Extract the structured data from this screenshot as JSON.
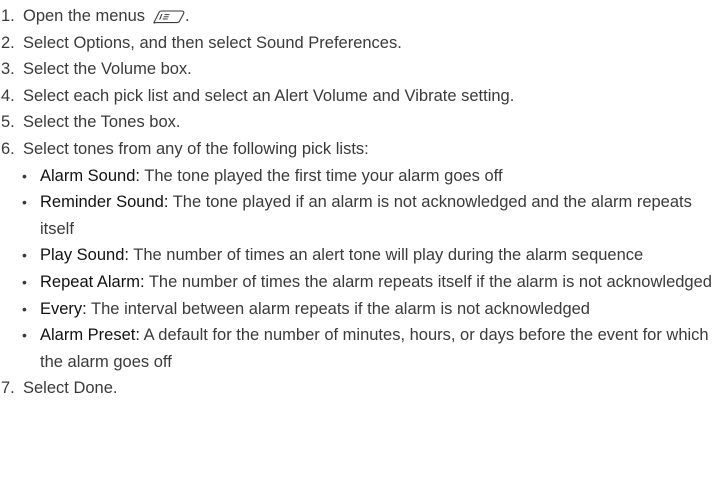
{
  "steps": [
    {
      "num": "1.",
      "text": "Open the menus",
      "suffix": ".",
      "icon": "menu-key-icon"
    },
    {
      "num": "2.",
      "text": "Select Options, and then select Sound Preferences."
    },
    {
      "num": "3.",
      "text": "Select the Volume box."
    },
    {
      "num": "4.",
      "text": "Select each pick list and select an Alert Volume and Vibrate setting."
    },
    {
      "num": "5.",
      "text": "Select the Tones box."
    },
    {
      "num": "6.",
      "text": "Select tones from any of the following pick lists:"
    },
    {
      "num": "7.",
      "text": "Select Done."
    }
  ],
  "bullets": [
    {
      "dot": "•",
      "term": "Alarm Sound:",
      "desc": " The tone played the first time your alarm goes off"
    },
    {
      "dot": "•",
      "term": "Reminder Sound:",
      "desc": " The tone played if an alarm is not acknowledged and the alarm repeats itself"
    },
    {
      "dot": "•",
      "term": "Play Sound:",
      "desc": " The number of times an alert tone will play during the alarm sequence"
    },
    {
      "dot": "•",
      "term": "Repeat Alarm:",
      "desc": " The number of times the alarm repeats itself if the alarm is not acknowledged"
    },
    {
      "dot": "•",
      "term": "Every:",
      "desc": " The interval between alarm repeats if the alarm is not acknowledged"
    },
    {
      "dot": "•",
      "term": "Alarm Preset:",
      "desc": " A default for the number of minutes, hours, or days before the event for which the alarm goes off"
    }
  ]
}
